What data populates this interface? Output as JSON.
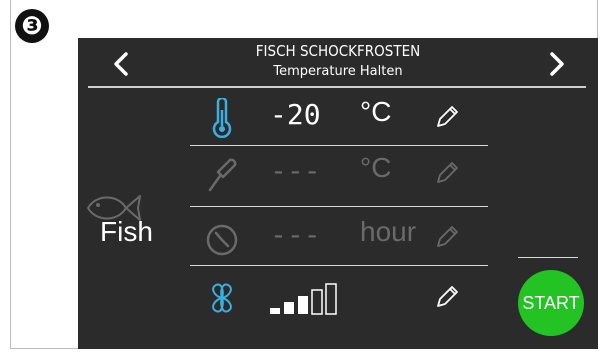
{
  "step_number": "❸",
  "header": {
    "title": "FISCH SCHOCKFROSTEN",
    "subtitle": "Temperature Halten",
    "prev_icon": "<",
    "next_icon": ">"
  },
  "product": {
    "label": "Fish",
    "icon": "fish-icon"
  },
  "rows": {
    "temperature": {
      "value": "-20",
      "unit": "°C",
      "icon": "thermometer-icon",
      "color": "#3ab0e0"
    },
    "probe": {
      "value": "---",
      "unit": "°C",
      "icon": "probe-icon"
    },
    "time": {
      "value": "---",
      "unit": "hour",
      "icon": "clock-icon"
    },
    "fan": {
      "icon": "fan-icon",
      "level": 3,
      "max_level": 5,
      "color": "#3ab0e0"
    }
  },
  "start_button": {
    "label": "START",
    "color": "#22c322"
  }
}
